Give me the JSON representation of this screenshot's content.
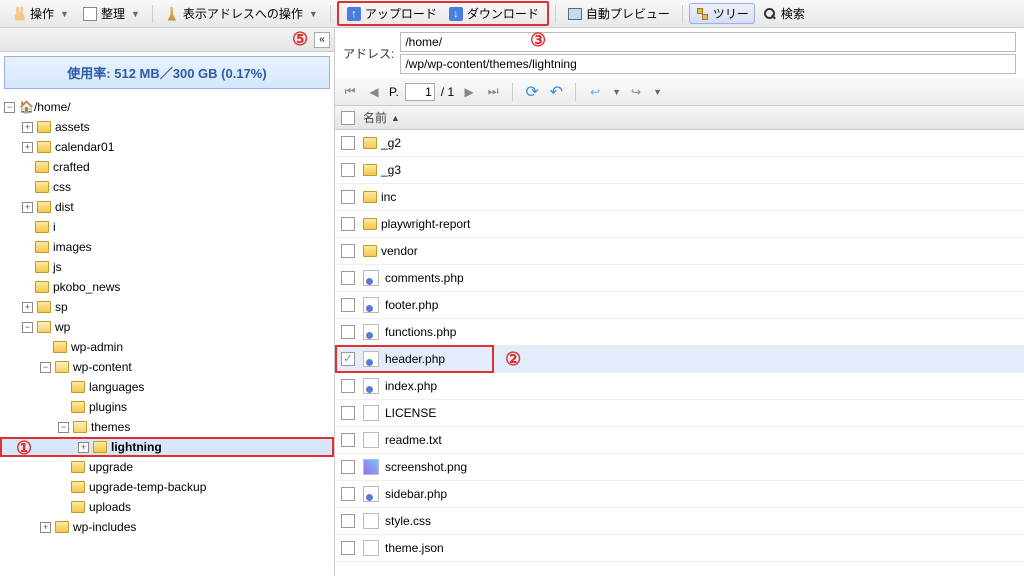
{
  "toolbar": {
    "operate": "操作",
    "organize": "整理",
    "addr_ops": "表示アドレスへの操作",
    "upload": "アップロード",
    "download": "ダウンロード",
    "auto_preview": "自動プレビュー",
    "tree": "ツリー",
    "search": "検索"
  },
  "annotations": {
    "n1": "①",
    "n2": "②",
    "n3": "③",
    "n5": "⑤"
  },
  "usage": "使用率: 512 MB／300 GB (0.17%)",
  "address": {
    "label": "アドレス:",
    "line1": "/home/",
    "line2": "/wp/wp-content/themes/lightning"
  },
  "paging": {
    "prefix": "P.",
    "current": "1",
    "total": "/ 1"
  },
  "list_header": {
    "name": "名前"
  },
  "tree": {
    "root": "/home/",
    "items": [
      {
        "indent": 1,
        "exp": "+",
        "label": "assets"
      },
      {
        "indent": 1,
        "exp": "+",
        "label": "calendar01"
      },
      {
        "indent": 1,
        "exp": "",
        "label": "crafted"
      },
      {
        "indent": 1,
        "exp": "",
        "label": "css"
      },
      {
        "indent": 1,
        "exp": "+",
        "label": "dist"
      },
      {
        "indent": 1,
        "exp": "",
        "label": "i"
      },
      {
        "indent": 1,
        "exp": "",
        "label": "images"
      },
      {
        "indent": 1,
        "exp": "",
        "label": "js"
      },
      {
        "indent": 1,
        "exp": "",
        "label": "pkobo_news"
      },
      {
        "indent": 1,
        "exp": "+",
        "label": "sp"
      },
      {
        "indent": 1,
        "exp": "-",
        "label": "wp"
      },
      {
        "indent": 2,
        "exp": "",
        "label": "wp-admin"
      },
      {
        "indent": 2,
        "exp": "-",
        "label": "wp-content"
      },
      {
        "indent": 3,
        "exp": "",
        "label": "languages"
      },
      {
        "indent": 3,
        "exp": "",
        "label": "plugins"
      },
      {
        "indent": 3,
        "exp": "-",
        "label": "themes"
      },
      {
        "indent": 4,
        "exp": "+",
        "label": "lightning",
        "selected": true,
        "bold": true
      },
      {
        "indent": 3,
        "exp": "",
        "label": "upgrade"
      },
      {
        "indent": 3,
        "exp": "",
        "label": "upgrade-temp-backup"
      },
      {
        "indent": 3,
        "exp": "",
        "label": "uploads"
      },
      {
        "indent": 2,
        "exp": "+",
        "label": "wp-includes"
      }
    ]
  },
  "files": [
    {
      "name": "_g2",
      "type": "folder"
    },
    {
      "name": "_g3",
      "type": "folder"
    },
    {
      "name": "inc",
      "type": "folder"
    },
    {
      "name": "playwright-report",
      "type": "folder"
    },
    {
      "name": "vendor",
      "type": "folder"
    },
    {
      "name": "comments.php",
      "type": "php"
    },
    {
      "name": "footer.php",
      "type": "php"
    },
    {
      "name": "functions.php",
      "type": "php"
    },
    {
      "name": "header.php",
      "type": "php",
      "selected": true,
      "checked": true,
      "annot": "n2"
    },
    {
      "name": "index.php",
      "type": "php"
    },
    {
      "name": "LICENSE",
      "type": "txt"
    },
    {
      "name": "readme.txt",
      "type": "txt"
    },
    {
      "name": "screenshot.png",
      "type": "img"
    },
    {
      "name": "sidebar.php",
      "type": "php"
    },
    {
      "name": "style.css",
      "type": "txt"
    },
    {
      "name": "theme.json",
      "type": "txt"
    }
  ]
}
